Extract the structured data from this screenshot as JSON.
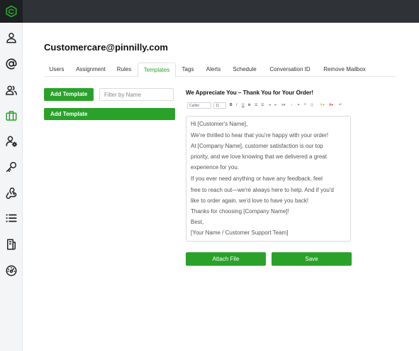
{
  "app": {
    "logo_icon": "hexagon-logo-icon",
    "accent": "#2aa22a",
    "topbar_color": "#2f3237"
  },
  "sidebar": {
    "items": [
      {
        "icon": "user-icon"
      },
      {
        "icon": "at-sign-icon"
      },
      {
        "icon": "users-icon"
      },
      {
        "icon": "briefcase-icon",
        "active": true
      },
      {
        "icon": "user-settings-icon"
      },
      {
        "icon": "key-icon"
      },
      {
        "icon": "webhook-icon"
      },
      {
        "icon": "list-icon"
      },
      {
        "icon": "document-icon"
      },
      {
        "icon": "dashboard-icon"
      }
    ]
  },
  "mailbox": {
    "title": "Customercare@pinnilly.com"
  },
  "tabs": [
    {
      "label": "Users"
    },
    {
      "label": "Assignment"
    },
    {
      "label": "Rules"
    },
    {
      "label": "Templates",
      "active": true
    },
    {
      "label": "Tags"
    },
    {
      "label": "Alerts"
    },
    {
      "label": "Schedule"
    },
    {
      "label": "Conversation ID"
    },
    {
      "label": "Remove Mailbox"
    }
  ],
  "templates_panel": {
    "add_button_label": "Add Template",
    "filter_placeholder": "Filter by Name",
    "list": [
      {
        "name": "Add Template"
      }
    ]
  },
  "editor": {
    "template_title": "We Appreciate You – Thank You for Your Order!",
    "toolbar": {
      "font": "Calibri",
      "size": "11"
    },
    "lines": [
      "Hi [Customer's Name],",
      "We're thrilled to hear that you're happy with your order!",
      "At [Company Name], customer satisfaction is our top",
      "priority, and we love knowing that we delivered a great",
      "experience for you.",
      "If you ever need anything or have any feedback, feel",
      "free to reach out—we're always here to help. And if you'd",
      "like to order again, we'd love to have you back!",
      "Thanks for choosing [Company Name]!",
      "Best,",
      "[Your Name / Customer Support Team]"
    ],
    "attach_label": "Attach File",
    "save_label": "Save"
  }
}
